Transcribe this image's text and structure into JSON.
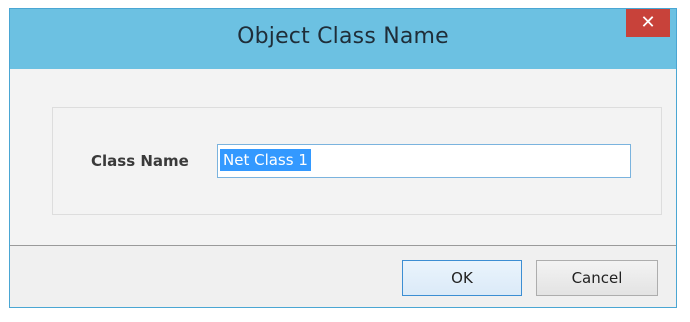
{
  "dialog": {
    "title": "Object Class Name",
    "close_glyph": "✕",
    "close_icon": "close-icon"
  },
  "form": {
    "class_name_label": "Class Name",
    "class_name_value": "Net Class 1"
  },
  "buttons": {
    "ok_label": "OK",
    "cancel_label": "Cancel"
  },
  "colors": {
    "titlebar": "#6cc1e2",
    "close_button": "#c8423a",
    "selection": "#3399ff",
    "input_border": "#7ab3de"
  }
}
